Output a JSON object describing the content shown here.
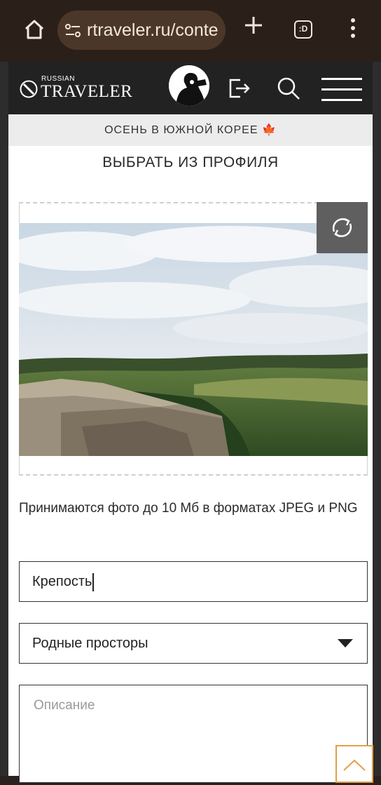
{
  "browser": {
    "url": "rtraveler.ru/conte",
    "tabs_label": ":D"
  },
  "site": {
    "logo_small": "RUSSIAN",
    "logo_big": "TRAVELER",
    "promo": "ОСЕНЬ В ЮЖНОЙ КОРЕЕ",
    "promo_icon": "🍁"
  },
  "form": {
    "pick_from_profile": "ВЫБРАТЬ ИЗ ПРОФИЛЯ",
    "hint": "Принимаются фото до 10 Мб в форматах JPEG и PNG",
    "title_value": "Крепость",
    "category_value": "Родные просторы",
    "description_placeholder": "Описание"
  },
  "colors": {
    "chrome_bg": "#2b1f19",
    "header_bg": "#222222",
    "accent_orange": "#e0a049"
  }
}
